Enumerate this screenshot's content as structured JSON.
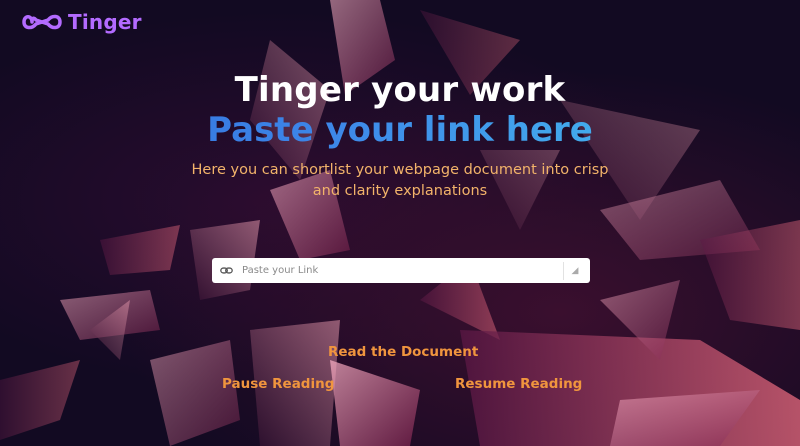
{
  "header": {
    "brand": "Tinger",
    "logo_icon": "infinity-icon",
    "brand_color": "#b36bff"
  },
  "hero": {
    "title": "Tinger your work",
    "subtitle_highlight": "Paste your link here",
    "description": "Here you can shortlist your webpage document into crisp and clarity explanations"
  },
  "link_input": {
    "placeholder": "Paste your Link",
    "value": "",
    "icon": "link-icon"
  },
  "actions": {
    "read": "Read the Document",
    "pause": "Pause Reading",
    "resume": "Resume Reading"
  },
  "colors": {
    "background": "#120a22",
    "title": "#ffffff",
    "gradient_start": "#2f6bd9",
    "gradient_end": "#47c6f0",
    "subtitle": "#f2b36a",
    "action": "#f0953e"
  }
}
